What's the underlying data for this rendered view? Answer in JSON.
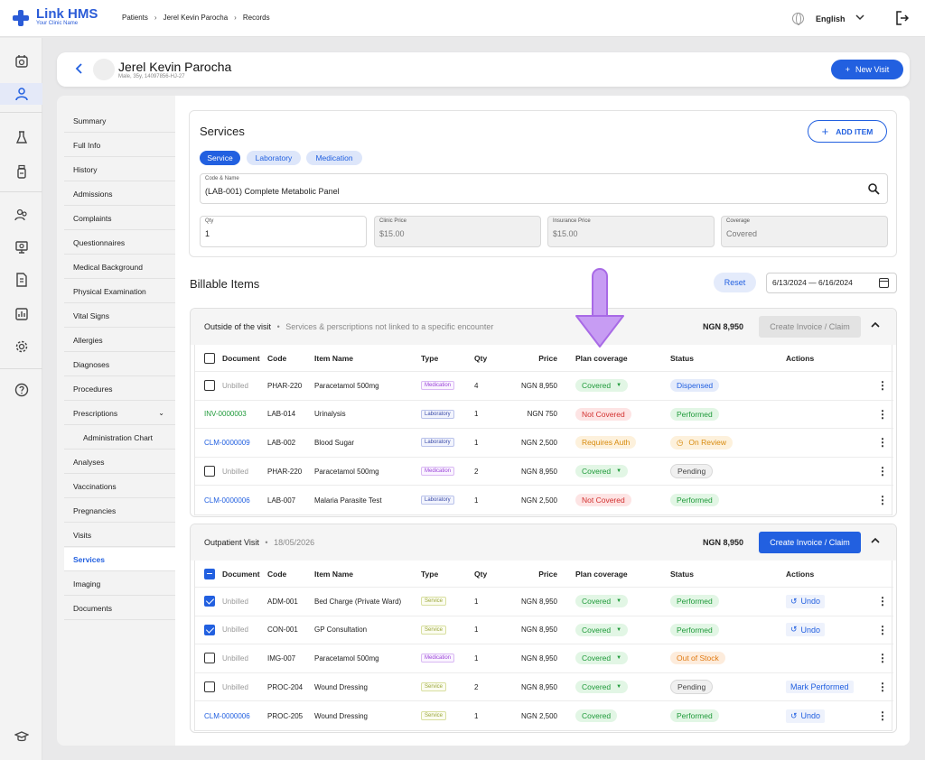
{
  "app": {
    "name": "Link HMS",
    "tagline": "Your Clinic Name"
  },
  "breadcrumb": [
    "Patients",
    "Jerel Kevin Parocha",
    "Records"
  ],
  "language": "English",
  "patient": {
    "name": "Jerel Kevin Parocha",
    "details": "Male, 35y, 14097856-HJ-27"
  },
  "new_visit_label": "New Visit",
  "nav": [
    "Summary",
    "Full Info",
    "History",
    "Admissions",
    "Complaints",
    "Questionnaires",
    "Medical Background",
    "Physical Examination",
    "Vital Signs",
    "Allergies",
    "Diagnoses",
    "Procedures",
    "Prescriptions",
    "Administration Chart",
    "Analyses",
    "Vaccinations",
    "Pregnancies",
    "Visits",
    "Services",
    "Imaging",
    "Documents"
  ],
  "services": {
    "title": "Services",
    "add_item": "ADD ITEM",
    "chips": [
      "Service",
      "Laboratory",
      "Medication"
    ],
    "code_name_label": "Code & Name",
    "code_name_value": "(LAB-001) Complete Metabolic Panel",
    "qty_label": "Qty",
    "qty_value": "1",
    "clinic_price_label": "Clinic Price",
    "clinic_price_value": "$15.00",
    "insurance_price_label": "Insurance Price",
    "insurance_price_value": "$15.00",
    "coverage_label": "Coverage",
    "coverage_value": "Covered"
  },
  "billable": {
    "title": "Billable Items",
    "reset": "Reset",
    "date_range": "6/13/2024 — 6/16/2024"
  },
  "columns": [
    "Document",
    "Code",
    "Item Name",
    "Type",
    "Qty",
    "Price",
    "Plan coverage",
    "Status",
    "Actions"
  ],
  "section1": {
    "title": "Outside of the visit",
    "subtitle": "Services & perscriptions not linked to a specific encounter",
    "total": "NGN 8,950",
    "button": "Create Invoice / Claim",
    "rows": [
      {
        "doc": "Unbilled",
        "code": "PHAR-220",
        "name": "Paracetamol 500mg",
        "type": "Medication",
        "qty": "4",
        "price": "NGN 8,950",
        "coverage": "Covered",
        "status": "Dispensed",
        "action": ""
      },
      {
        "doc": "INV-0000003",
        "code": "LAB-014",
        "name": "Urinalysis",
        "type": "Laboratory",
        "qty": "1",
        "price": "NGN 750",
        "coverage": "Not Covered",
        "status": "Performed",
        "action": ""
      },
      {
        "doc": "CLM-0000009",
        "code": "LAB-002",
        "name": "Blood Sugar",
        "type": "Laboratory",
        "qty": "1",
        "price": "NGN 2,500",
        "coverage": "Requires Auth",
        "status": "On Review",
        "action": ""
      },
      {
        "doc": "Unbilled",
        "code": "PHAR-220",
        "name": "Paracetamol 500mg",
        "type": "Medication",
        "qty": "2",
        "price": "NGN 8,950",
        "coverage": "Covered",
        "status": "Pending",
        "action": ""
      },
      {
        "doc": "CLM-0000006",
        "code": "LAB-007",
        "name": "Malaria Parasite Test",
        "type": "Laboratory",
        "qty": "1",
        "price": "NGN 2,500",
        "coverage": "Not Covered",
        "status": "Performed",
        "action": ""
      }
    ]
  },
  "section2": {
    "title": "Outpatient Visit",
    "subtitle": "18/05/2026",
    "total": "NGN 8,950",
    "button": "Create Invoice / Claim",
    "rows": [
      {
        "doc": "Unbilled",
        "code": "ADM-001",
        "name": "Bed Charge (Private Ward)",
        "type": "Service",
        "qty": "1",
        "price": "NGN 8,950",
        "coverage": "Covered",
        "status": "Performed",
        "action": "Undo"
      },
      {
        "doc": "Unbilled",
        "code": "CON-001",
        "name": "GP Consultation",
        "type": "Service",
        "qty": "1",
        "price": "NGN 8,950",
        "coverage": "Covered",
        "status": "Performed",
        "action": "Undo"
      },
      {
        "doc": "Unbilled",
        "code": "IMG-007",
        "name": "Paracetamol 500mg",
        "type": "Medication",
        "qty": "1",
        "price": "NGN 8,950",
        "coverage": "Covered",
        "status": "Out of Stock",
        "action": ""
      },
      {
        "doc": "Unbilled",
        "code": "PROC-204",
        "name": "Wound Dressing",
        "type": "Service",
        "qty": "2",
        "price": "NGN 8,950",
        "coverage": "Covered",
        "status": "Pending",
        "action": "Mark Performed"
      },
      {
        "doc": "CLM-0000006",
        "code": "PROC-205",
        "name": "Wound Dressing",
        "type": "Service",
        "qty": "1",
        "price": "NGN 2,500",
        "coverage": "Covered",
        "status": "Performed",
        "action": "Undo"
      }
    ]
  }
}
